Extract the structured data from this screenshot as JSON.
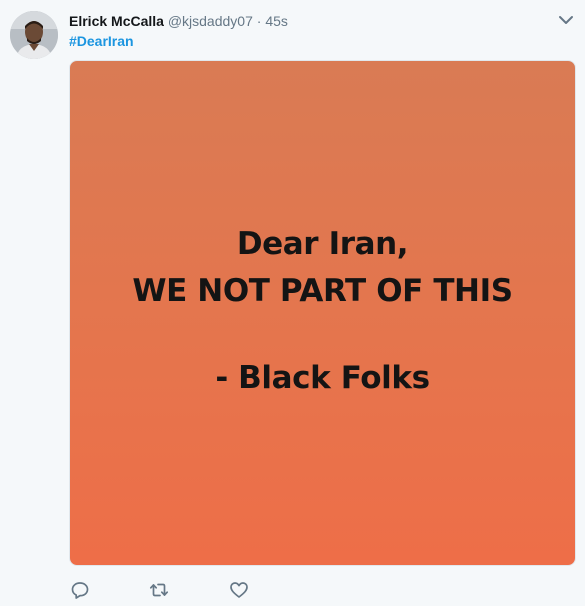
{
  "tweet": {
    "author": {
      "name": "Elrick McCalla",
      "handle": "@kjsdaddy07",
      "avatar_icon": "avatar-photo"
    },
    "separator": "·",
    "timestamp": "45s",
    "hashtag": "#DearIran",
    "menu_icon": "chevron-down-icon",
    "media": {
      "background_color": "#e5754d",
      "lines": [
        "Dear Iran,",
        "WE NOT PART OF THIS",
        "- Black Folks"
      ]
    },
    "actions": {
      "reply_icon": "reply-icon",
      "retweet_icon": "retweet-icon",
      "like_icon": "heart-icon"
    }
  }
}
